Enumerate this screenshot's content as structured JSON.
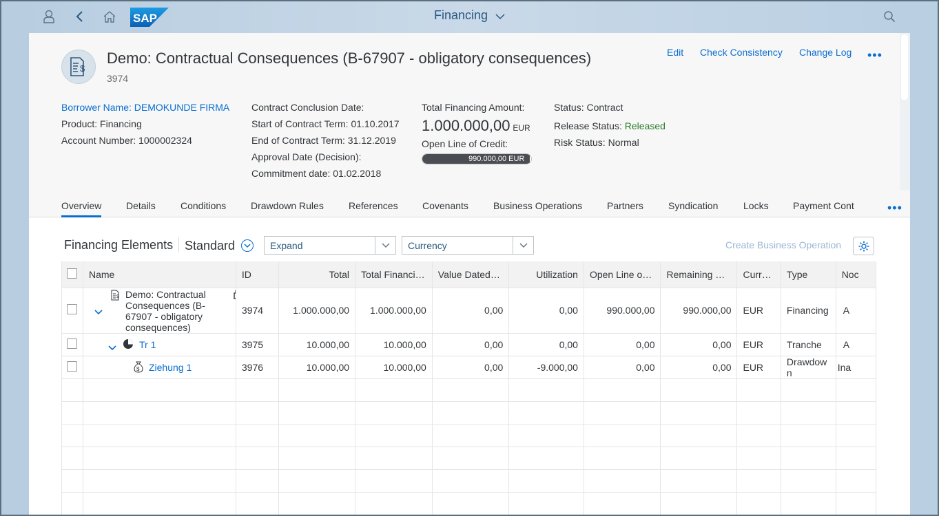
{
  "shell": {
    "title": "Financing",
    "logo_text": "SAP",
    "icons": [
      "user-icon",
      "back-icon",
      "home-icon",
      "search-icon"
    ]
  },
  "header": {
    "title": "Demo: Contractual Consequences (B-67907 - obligatory consequences)",
    "subtitle": "3974",
    "actions": {
      "edit": "Edit",
      "check": "Check Consistency",
      "changelog": "Change Log",
      "more": "•••"
    },
    "col1": {
      "borrower": "Borrower Name: DEMOKUNDE FIRMA",
      "product": "Product: Financing",
      "account": "Account Number: 1000002324"
    },
    "col2": {
      "conclusion": "Contract Conclusion Date:",
      "start": "Start of Contract Term: 01.10.2017",
      "end": "End of Contract Term: 31.12.2019",
      "approval": "Approval Date (Decision):",
      "commitment": "Commitment date: 01.02.2018"
    },
    "col3": {
      "total_label": "Total Financing Amount:",
      "total_value": "1.000.000,00",
      "total_unit": "EUR",
      "credit_label": "Open Line of Credit:",
      "credit_bar_text": "990.000,00 EUR",
      "credit_fraction": 0.99
    },
    "col4": {
      "status": "Status: Contract",
      "release_label": "Release Status: ",
      "release_value": "Released",
      "risk": "Risk Status: Normal"
    }
  },
  "tabs": [
    "Overview",
    "Details",
    "Conditions",
    "Drawdown Rules",
    "References",
    "Covenants",
    "Business Operations",
    "Partners",
    "Syndication",
    "Locks",
    "Payment Contro"
  ],
  "tabs_more": "•••",
  "toolbar": {
    "title": "Financing Elements",
    "variant": "Standard",
    "expand": "Expand",
    "currency": "Currency",
    "create_op": "Create Business Operation"
  },
  "table": {
    "columns": [
      "Name",
      "ID",
      "Total",
      "Total Financi…",
      "Value Dated…",
      "Utilization",
      "Open Line o…",
      "Remaining …",
      "Curr…",
      "Type",
      "Noc"
    ],
    "rows": [
      {
        "name": "Demo: Contractual Consequences (B-67907 - obligatory consequences)",
        "id": "3974",
        "total": "1.000.000,00",
        "total_fin": "1.000.000,00",
        "value_dated": "0,00",
        "utilization": "0,00",
        "open_line": "990.000,00",
        "remaining": "990.000,00",
        "curr": "EUR",
        "type": "Financing",
        "noc": "A"
      },
      {
        "name": "Tr 1",
        "id": "3975",
        "total": "10.000,00",
        "total_fin": "10.000,00",
        "value_dated": "0,00",
        "utilization": "0,00",
        "open_line": "0,00",
        "remaining": "0,00",
        "curr": "EUR",
        "type": "Tranche",
        "noc": "A"
      },
      {
        "name": "Ziehung 1",
        "id": "3976",
        "total": "10.000,00",
        "total_fin": "10.000,00",
        "value_dated": "0,00",
        "utilization": "-9.000,00",
        "open_line": "0,00",
        "remaining": "0,00",
        "curr": "EUR",
        "type": "Drawdow n",
        "noc": "Ina"
      }
    ]
  }
}
